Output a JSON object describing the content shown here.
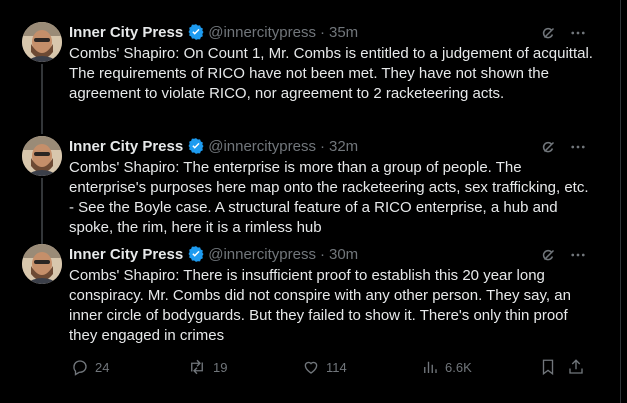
{
  "author": {
    "name": "Inner City Press",
    "handle": "@innercitypress"
  },
  "tweets": [
    {
      "time": "35m",
      "text": "Combs' Shapiro: On Count 1, Mr. Combs is entitled to a judgement of acquittal. The requirements of RICO have not been met. They have not shown the agreement to violate RICO, nor agreement to 2 racketeering acts."
    },
    {
      "time": "32m",
      "text": "Combs' Shapiro: The enterprise is more than a group of people. The enterprise's purposes here map onto the racketeering acts, sex trafficking, etc. - See the Boyle case. A structural feature of a RICO enterprise, a hub and spoke, the rim, here it is a rimless hub"
    },
    {
      "time": "30m",
      "text": "Combs' Shapiro: There is insufficient proof to establish this 20 year long conspiracy. Mr. Combs did not conspire with any other person. They say, an inner circle of bodyguards. But they failed to show it. There's only thin proof they engaged in crimes"
    }
  ],
  "meta_separator": "·",
  "actions": {
    "replies": "24",
    "reposts": "19",
    "likes": "114",
    "views": "6.6K"
  },
  "icons": [
    "verified-badge-icon",
    "grok-icon",
    "more-icon",
    "reply-icon",
    "repost-icon",
    "like-icon",
    "views-icon",
    "bookmark-icon",
    "share-icon"
  ],
  "colors": {
    "background": "#000000",
    "text": "#e7e9ea",
    "muted": "#71767b",
    "verified": "#1d9bf0",
    "thread_line": "#333639"
  }
}
